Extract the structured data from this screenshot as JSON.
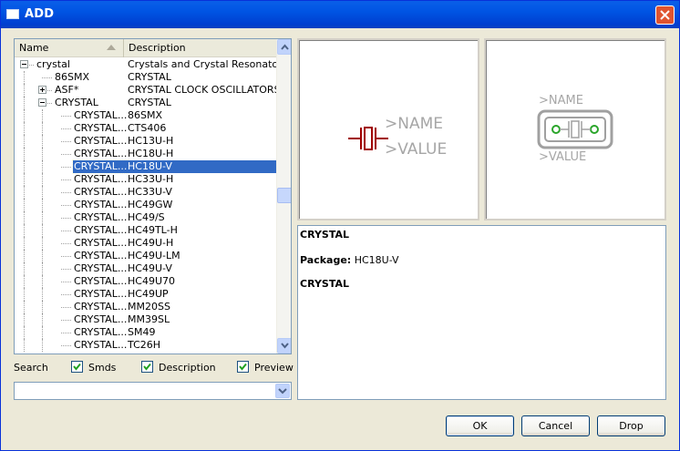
{
  "window": {
    "title": "ADD"
  },
  "tree": {
    "columns": {
      "name": "Name",
      "description": "Description"
    },
    "rows": [
      {
        "name": "crystal",
        "desc": "Crystals and Crystal Resonators",
        "depth": 0,
        "expander": "minus"
      },
      {
        "name": "86SMX",
        "desc": "CRYSTAL",
        "depth": 1,
        "expander": "none"
      },
      {
        "name": "ASF*",
        "desc": "CRYSTAL CLOCK OSCILLATORS",
        "depth": 1,
        "expander": "plus"
      },
      {
        "name": "CRYSTAL",
        "desc": "CRYSTAL",
        "depth": 1,
        "expander": "minus"
      },
      {
        "name": "CRYSTAL...",
        "desc": "86SMX",
        "depth": 2,
        "expander": "none"
      },
      {
        "name": "CRYSTAL...",
        "desc": "CTS406",
        "depth": 2,
        "expander": "none"
      },
      {
        "name": "CRYSTAL...",
        "desc": "HC13U-H",
        "depth": 2,
        "expander": "none"
      },
      {
        "name": "CRYSTAL...",
        "desc": "HC18U-H",
        "depth": 2,
        "expander": "none"
      },
      {
        "name": "CRYSTAL...",
        "desc": "HC18U-V",
        "depth": 2,
        "expander": "none",
        "selected": true
      },
      {
        "name": "CRYSTAL...",
        "desc": "HC33U-H",
        "depth": 2,
        "expander": "none"
      },
      {
        "name": "CRYSTAL...",
        "desc": "HC33U-V",
        "depth": 2,
        "expander": "none"
      },
      {
        "name": "CRYSTAL...",
        "desc": "HC49GW",
        "depth": 2,
        "expander": "none"
      },
      {
        "name": "CRYSTAL...",
        "desc": "HC49/S",
        "depth": 2,
        "expander": "none"
      },
      {
        "name": "CRYSTAL...",
        "desc": "HC49TL-H",
        "depth": 2,
        "expander": "none"
      },
      {
        "name": "CRYSTAL...",
        "desc": "HC49U-H",
        "depth": 2,
        "expander": "none"
      },
      {
        "name": "CRYSTAL...",
        "desc": "HC49U-LM",
        "depth": 2,
        "expander": "none"
      },
      {
        "name": "CRYSTAL...",
        "desc": "HC49U-V",
        "depth": 2,
        "expander": "none"
      },
      {
        "name": "CRYSTAL...",
        "desc": "HC49U70",
        "depth": 2,
        "expander": "none"
      },
      {
        "name": "CRYSTAL...",
        "desc": "HC49UP",
        "depth": 2,
        "expander": "none"
      },
      {
        "name": "CRYSTAL...",
        "desc": "MM20SS",
        "depth": 2,
        "expander": "none"
      },
      {
        "name": "CRYSTAL...",
        "desc": "MM39SL",
        "depth": 2,
        "expander": "none"
      },
      {
        "name": "CRYSTAL...",
        "desc": "SM49",
        "depth": 2,
        "expander": "none"
      },
      {
        "name": "CRYSTAL...",
        "desc": "TC26H",
        "depth": 2,
        "expander": "none"
      }
    ]
  },
  "filters": {
    "search_label": "Search",
    "smds": {
      "label": "Smds",
      "checked": true
    },
    "description": {
      "label": "Description",
      "checked": true
    },
    "preview": {
      "label": "Preview",
      "checked": true
    },
    "search_value": ""
  },
  "symbol_preview": {
    "name_text": ">NAME",
    "value_text": ">VALUE"
  },
  "package_preview": {
    "name_text": ">NAME",
    "value_text": ">VALUE"
  },
  "info": {
    "title": "CRYSTAL",
    "package_label": "Package:",
    "package_value": "HC18U-V",
    "description": "CRYSTAL"
  },
  "buttons": {
    "ok": "OK",
    "cancel": "Cancel",
    "drop": "Drop"
  },
  "colors": {
    "selection": "#316ac5",
    "titlebar": "#0054e3",
    "symbol_red": "#a00000",
    "package_green": "#2aa52a"
  }
}
